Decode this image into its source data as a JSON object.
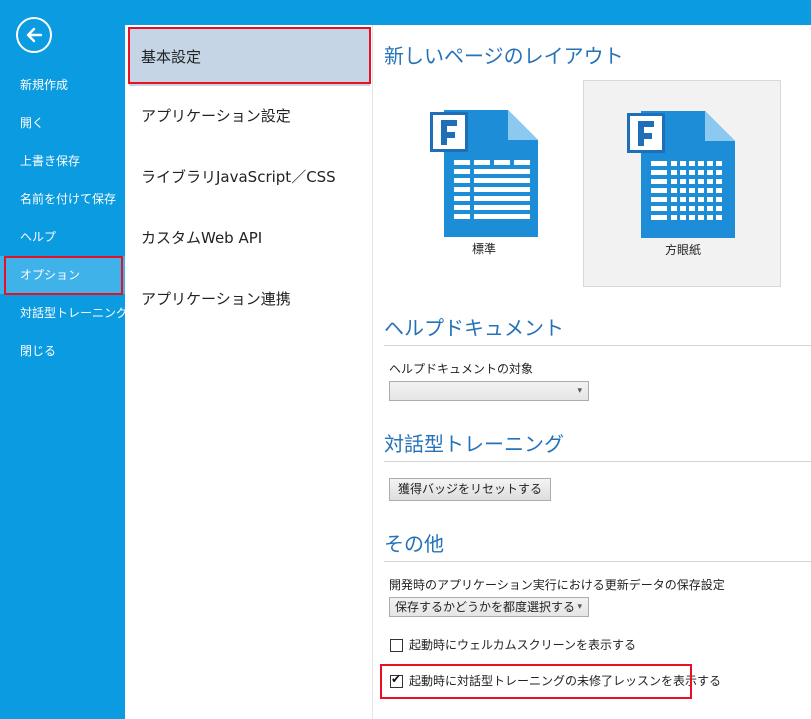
{
  "sidebar": {
    "back_icon": "back-arrow-icon",
    "items": [
      {
        "label": "新規作成"
      },
      {
        "label": "開く"
      },
      {
        "label": "上書き保存"
      },
      {
        "label": "名前を付けて保存"
      },
      {
        "label": "ヘルプ"
      },
      {
        "label": "オプション",
        "active": true
      },
      {
        "label": "対話型トレーニング"
      },
      {
        "label": "閉じる"
      }
    ]
  },
  "categories": [
    {
      "label": "基本設定",
      "active": true
    },
    {
      "label": "アプリケーション設定"
    },
    {
      "label": "ライブラリJavaScript／CSS"
    },
    {
      "label": "カスタムWeb API"
    },
    {
      "label": "アプリケーション連携"
    }
  ],
  "page_layout": {
    "title": "新しいページのレイアウト",
    "options": [
      {
        "label": "標準",
        "icon": "standard-layout-icon",
        "selected": false
      },
      {
        "label": "方眼紙",
        "icon": "grid-layout-icon",
        "selected": true
      }
    ]
  },
  "help_doc": {
    "title": "ヘルプドキュメント",
    "target_label": "ヘルプドキュメントの対象",
    "target_value": ""
  },
  "training": {
    "title": "対話型トレーニング",
    "reset_button": "獲得バッジをリセットする"
  },
  "other": {
    "title": "その他",
    "save_setting_label": "開発時のアプリケーション実行における更新データの保存設定",
    "save_setting_value": "保存するかどうかを都度選択する",
    "welcome_checkbox": {
      "label": "起動時にウェルカムスクリーンを表示する",
      "checked": false
    },
    "lesson_checkbox": {
      "label": "起動時に対話型トレーニングの未修了レッスンを表示する",
      "checked": true
    }
  },
  "colors": {
    "accent_blue": "#0A9BE0",
    "sidebar_active": "#3FB2EA",
    "highlight_red": "#E81123",
    "section_title": "#2672B9",
    "category_active": "#C5D5E5"
  }
}
